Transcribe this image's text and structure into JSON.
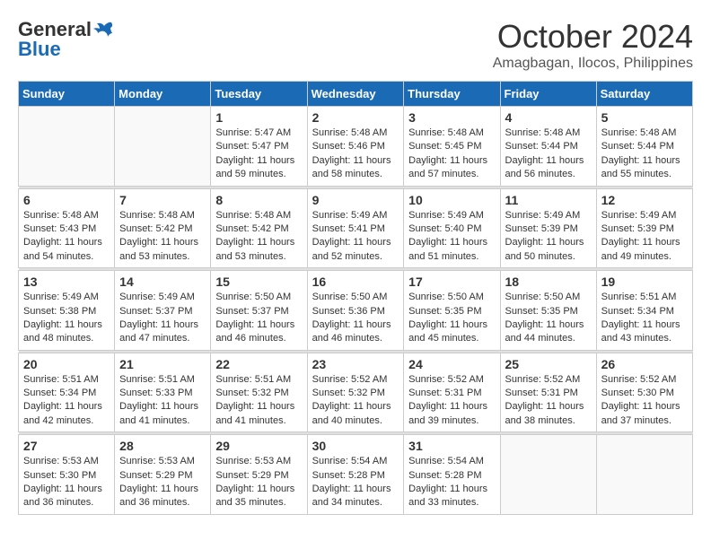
{
  "logo": {
    "general": "General",
    "blue": "Blue"
  },
  "title": "October 2024",
  "location": "Amagbagan, Ilocos, Philippines",
  "weekdays": [
    "Sunday",
    "Monday",
    "Tuesday",
    "Wednesday",
    "Thursday",
    "Friday",
    "Saturday"
  ],
  "weeks": [
    [
      {
        "day": "",
        "info": ""
      },
      {
        "day": "",
        "info": ""
      },
      {
        "day": "1",
        "info": "Sunrise: 5:47 AM\nSunset: 5:47 PM\nDaylight: 11 hours and 59 minutes."
      },
      {
        "day": "2",
        "info": "Sunrise: 5:48 AM\nSunset: 5:46 PM\nDaylight: 11 hours and 58 minutes."
      },
      {
        "day": "3",
        "info": "Sunrise: 5:48 AM\nSunset: 5:45 PM\nDaylight: 11 hours and 57 minutes."
      },
      {
        "day": "4",
        "info": "Sunrise: 5:48 AM\nSunset: 5:44 PM\nDaylight: 11 hours and 56 minutes."
      },
      {
        "day": "5",
        "info": "Sunrise: 5:48 AM\nSunset: 5:44 PM\nDaylight: 11 hours and 55 minutes."
      }
    ],
    [
      {
        "day": "6",
        "info": "Sunrise: 5:48 AM\nSunset: 5:43 PM\nDaylight: 11 hours and 54 minutes."
      },
      {
        "day": "7",
        "info": "Sunrise: 5:48 AM\nSunset: 5:42 PM\nDaylight: 11 hours and 53 minutes."
      },
      {
        "day": "8",
        "info": "Sunrise: 5:48 AM\nSunset: 5:42 PM\nDaylight: 11 hours and 53 minutes."
      },
      {
        "day": "9",
        "info": "Sunrise: 5:49 AM\nSunset: 5:41 PM\nDaylight: 11 hours and 52 minutes."
      },
      {
        "day": "10",
        "info": "Sunrise: 5:49 AM\nSunset: 5:40 PM\nDaylight: 11 hours and 51 minutes."
      },
      {
        "day": "11",
        "info": "Sunrise: 5:49 AM\nSunset: 5:39 PM\nDaylight: 11 hours and 50 minutes."
      },
      {
        "day": "12",
        "info": "Sunrise: 5:49 AM\nSunset: 5:39 PM\nDaylight: 11 hours and 49 minutes."
      }
    ],
    [
      {
        "day": "13",
        "info": "Sunrise: 5:49 AM\nSunset: 5:38 PM\nDaylight: 11 hours and 48 minutes."
      },
      {
        "day": "14",
        "info": "Sunrise: 5:49 AM\nSunset: 5:37 PM\nDaylight: 11 hours and 47 minutes."
      },
      {
        "day": "15",
        "info": "Sunrise: 5:50 AM\nSunset: 5:37 PM\nDaylight: 11 hours and 46 minutes."
      },
      {
        "day": "16",
        "info": "Sunrise: 5:50 AM\nSunset: 5:36 PM\nDaylight: 11 hours and 46 minutes."
      },
      {
        "day": "17",
        "info": "Sunrise: 5:50 AM\nSunset: 5:35 PM\nDaylight: 11 hours and 45 minutes."
      },
      {
        "day": "18",
        "info": "Sunrise: 5:50 AM\nSunset: 5:35 PM\nDaylight: 11 hours and 44 minutes."
      },
      {
        "day": "19",
        "info": "Sunrise: 5:51 AM\nSunset: 5:34 PM\nDaylight: 11 hours and 43 minutes."
      }
    ],
    [
      {
        "day": "20",
        "info": "Sunrise: 5:51 AM\nSunset: 5:34 PM\nDaylight: 11 hours and 42 minutes."
      },
      {
        "day": "21",
        "info": "Sunrise: 5:51 AM\nSunset: 5:33 PM\nDaylight: 11 hours and 41 minutes."
      },
      {
        "day": "22",
        "info": "Sunrise: 5:51 AM\nSunset: 5:32 PM\nDaylight: 11 hours and 41 minutes."
      },
      {
        "day": "23",
        "info": "Sunrise: 5:52 AM\nSunset: 5:32 PM\nDaylight: 11 hours and 40 minutes."
      },
      {
        "day": "24",
        "info": "Sunrise: 5:52 AM\nSunset: 5:31 PM\nDaylight: 11 hours and 39 minutes."
      },
      {
        "day": "25",
        "info": "Sunrise: 5:52 AM\nSunset: 5:31 PM\nDaylight: 11 hours and 38 minutes."
      },
      {
        "day": "26",
        "info": "Sunrise: 5:52 AM\nSunset: 5:30 PM\nDaylight: 11 hours and 37 minutes."
      }
    ],
    [
      {
        "day": "27",
        "info": "Sunrise: 5:53 AM\nSunset: 5:30 PM\nDaylight: 11 hours and 36 minutes."
      },
      {
        "day": "28",
        "info": "Sunrise: 5:53 AM\nSunset: 5:29 PM\nDaylight: 11 hours and 36 minutes."
      },
      {
        "day": "29",
        "info": "Sunrise: 5:53 AM\nSunset: 5:29 PM\nDaylight: 11 hours and 35 minutes."
      },
      {
        "day": "30",
        "info": "Sunrise: 5:54 AM\nSunset: 5:28 PM\nDaylight: 11 hours and 34 minutes."
      },
      {
        "day": "31",
        "info": "Sunrise: 5:54 AM\nSunset: 5:28 PM\nDaylight: 11 hours and 33 minutes."
      },
      {
        "day": "",
        "info": ""
      },
      {
        "day": "",
        "info": ""
      }
    ]
  ]
}
